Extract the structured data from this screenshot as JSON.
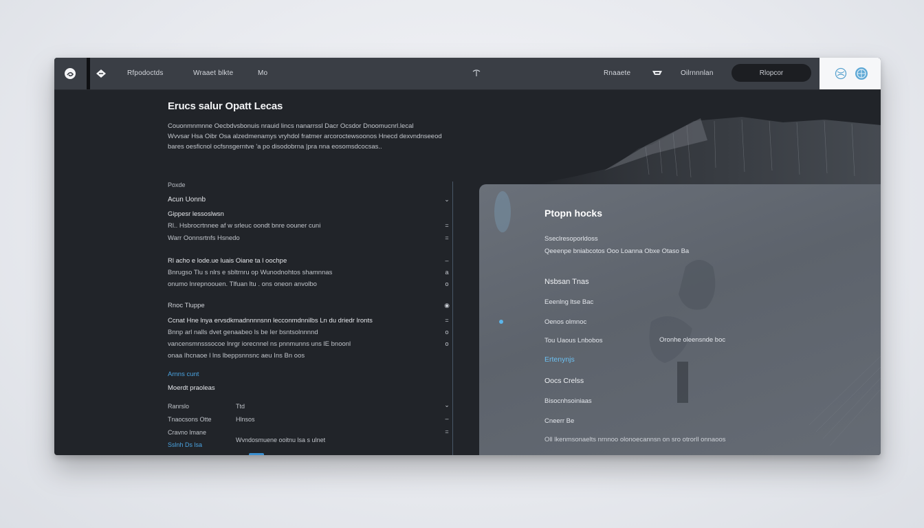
{
  "topbar": {
    "logo_icon": "swirl-logo-icon",
    "brand_icon": "bird-icon",
    "nav": [
      "Rfpodoctds",
      "Wraaet blkte",
      "Mo"
    ],
    "center_icon": "pin-icon",
    "right_links": [
      "Rnaaete",
      "Oilrnnnlan"
    ],
    "hat_icon": "hat-icon",
    "cta_label": "Rlopcor",
    "icons_right": [
      "globe-outline-icon",
      "globe-filled-icon"
    ]
  },
  "main": {
    "title": "Erucs salur Opatt Lecas",
    "intro": [
      "Couonmnmnne Oecbdvsbonuis nrauid lincs nanarrssl Dacr Ocsdor Dnoomucnrl.lecal",
      "Wvvsar Hsa Oibr Osa alzedmenamys vryhdol fratmer arcoroctewsoonos Hnecd dexvndnseeod",
      "bares oesficnol ocfsnsgerntve 'a po disodobrna |pra nna eosomsdcocsas.."
    ],
    "groups": [
      {
        "label": "Poxde",
        "rows": [
          {
            "text": "Acun Uonnb",
            "ctl": "⌄"
          },
          {
            "text": "Gippesr lessoslwsn",
            "ctl": ""
          },
          {
            "text": "Rl.. Hsbrocrtnnee af w srleuc oondt bnre oouner cuni",
            "ctl": "="
          },
          {
            "text": "Warr Oonnsrtnfs Hsnedo",
            "ctl": "="
          }
        ]
      },
      {
        "label": "",
        "rows": [
          {
            "text": "Rl acho e lode.ue luais Oiane ta l oochpe",
            "ctl": "–"
          },
          {
            "text": "Bnrugso Tlu s nlrs e sbltrnru op Wunodnohtos shamnnas",
            "ctl": "a"
          },
          {
            "text": "onumo lnrepnoouen. Tlfuan  ltu . ons  oneon anvolbo",
            "ctl": "o"
          }
        ]
      },
      {
        "label": "Rnoc Tluppe",
        "rows": [
          {
            "text": "Ccnat Hne lnya ervsdkmadnnnnsnn lecconmdnnilbs Ln du driedr lronts",
            "ctl": "="
          },
          {
            "text": "Bnnp arl nalls dvet genaabeo ls  be Ier bsntsolnnnnd",
            "ctl": "o"
          },
          {
            "text": "vancensmnsssocoe lnrgr iorecnnel ns pnnmunns uns lE bnoonl",
            "ctl": "o"
          },
          {
            "text": "onaa Ihcnaoe l lns lbeppsnnsnc aeu Ins Bn oos",
            "ctl": ""
          }
        ]
      }
    ],
    "link_label": "Arnns cunt",
    "sub_label": "Moerdt praoleas",
    "table": [
      {
        "c1": "Ranrslo",
        "c2": "Ttd",
        "ctl": "⌄"
      },
      {
        "c1": "Tnaocsons Otte",
        "c2": "Hlnsos",
        "ctl": "–"
      },
      {
        "c1": "Cravno lmane",
        "c2": "",
        "ctl": "="
      },
      {
        "c1": "Sslnh Ds lsa",
        "c2": "Wvndosmuene ooitnu lsa s ulnet",
        "ctl": ""
      }
    ]
  },
  "panel": {
    "title": "Ptopn hocks",
    "subline1": "Sseclresoporldoss",
    "subline2": "Qeeenpe bniabcotos Ooo Loanna Obxe Otaso Ba",
    "heading": "Nsbsan Tnas",
    "items": [
      "Eeenlng ltse Bac",
      "Oenos olmnoc",
      "Tou Uaous Lnbobos",
      "Ertenynjs",
      "Oocs Crelss",
      "Bisocnhsoiniaas",
      "Cneerr Be"
    ],
    "side_note": "Oronhe oleensnde boc",
    "footer": "Oll lkenmsonaelts nrnnoo olonoecannsn on sro otrorll onnaoos",
    "accent": "#6cc1f2"
  },
  "colors": {
    "window_bg": "#212429",
    "topbar_bg": "#3a3e45",
    "panel_bg": "#636973",
    "link": "#4aa3e0"
  }
}
